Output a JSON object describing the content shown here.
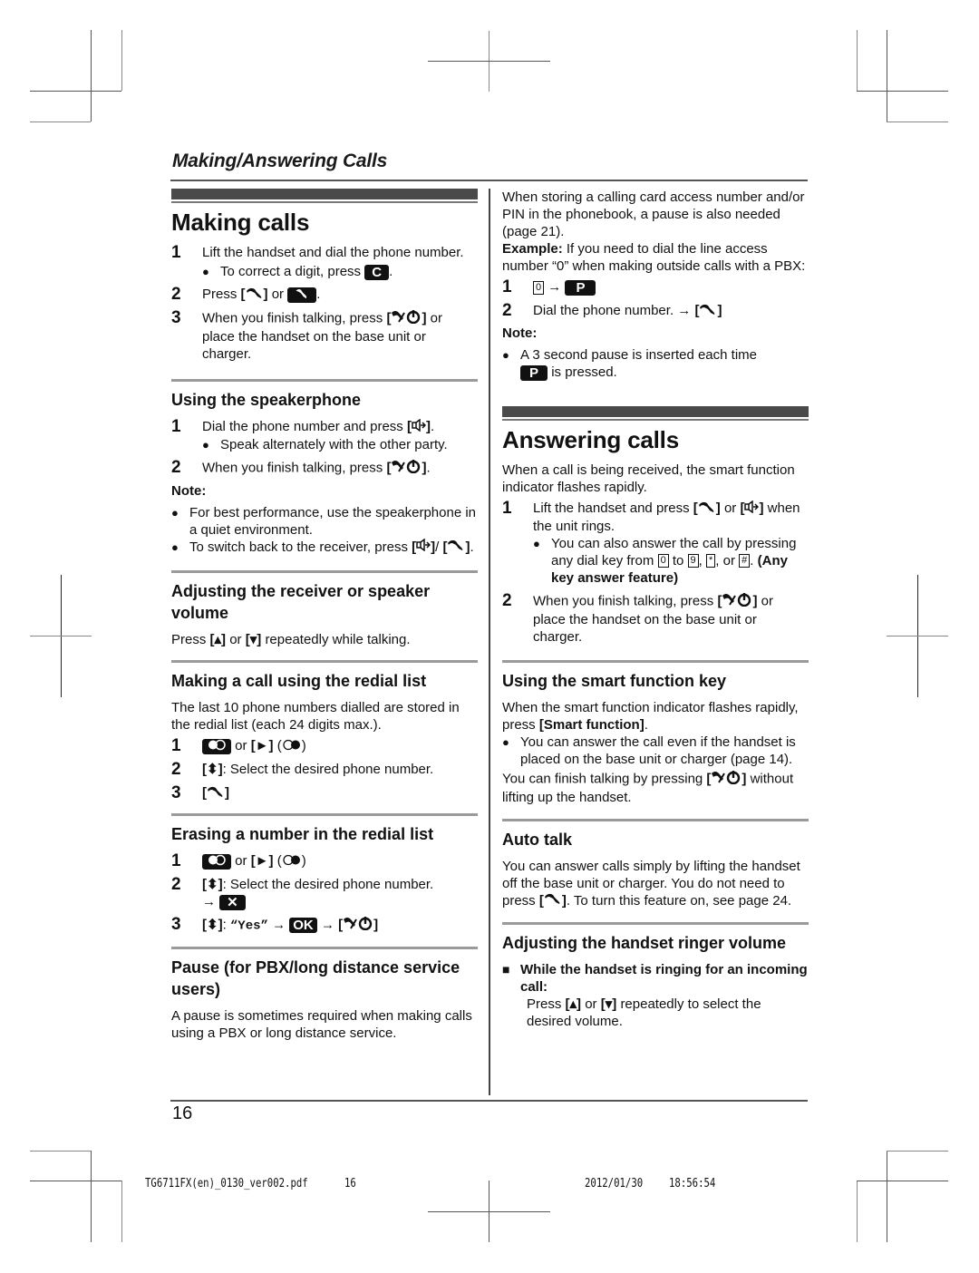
{
  "header": {
    "title": "Making/Answering Calls"
  },
  "left": {
    "making_calls": {
      "title": "Making calls",
      "steps": [
        {
          "num": "1",
          "text": "Lift the handset and dial the phone number.",
          "bullet": "To correct a digit, press",
          "key": "C"
        },
        {
          "num": "2",
          "text_a": "Press",
          "text_b": "or"
        },
        {
          "num": "3",
          "text_a": "When you finish talking, press",
          "text_b": "or place the handset on the base unit or charger."
        }
      ]
    },
    "speakerphone": {
      "title": "Using the speakerphone",
      "steps": [
        {
          "num": "1",
          "text": "Dial the phone number and press",
          "bullet": "Speak alternately with the other party."
        },
        {
          "num": "2",
          "text": "When you finish talking, press"
        }
      ],
      "note_label": "Note:",
      "notes": [
        "For best performance, use the speakerphone in a quiet environment.",
        "To switch back to the receiver, press"
      ]
    },
    "volume": {
      "title": "Adjusting the receiver or speaker volume",
      "text_a": "Press",
      "text_b": "or",
      "text_c": "repeatedly while talking."
    },
    "redial": {
      "title": "Making a call using the redial list",
      "intro": "The last 10 phone numbers dialled are stored in the redial list (each 24 digits max.).",
      "steps": [
        {
          "num": "1",
          "text": "or"
        },
        {
          "num": "2",
          "text": ": Select the desired phone number."
        },
        {
          "num": "3"
        }
      ]
    },
    "erase": {
      "title": "Erasing a number in the redial list",
      "steps": [
        {
          "num": "1",
          "text": "or"
        },
        {
          "num": "2",
          "text": ": Select the desired phone number."
        },
        {
          "num": "3",
          "yes": "“Yes”",
          "ok": "OK"
        }
      ]
    },
    "pause": {
      "title": "Pause (for PBX/long distance service users)",
      "text": "A pause is sometimes required when making calls using a PBX or long distance service."
    }
  },
  "right": {
    "pause_cont": {
      "text": "When storing a calling card access number and/or PIN in the phonebook, a pause is also needed (page 21).",
      "example_label": "Example:",
      "example_text": "If you need to dial the line access number “0” when making outside calls with a PBX:",
      "steps": [
        {
          "num": "1",
          "digit": "0",
          "key": "P"
        },
        {
          "num": "2",
          "text": "Dial the phone number."
        }
      ],
      "note_label": "Note:",
      "note_a": "A 3 second pause is inserted each time",
      "note_key": "P",
      "note_b": "is pressed."
    },
    "answering": {
      "title": "Answering calls",
      "intro": "When a call is being received, the smart function indicator flashes rapidly.",
      "steps": [
        {
          "num": "1",
          "text_a": "Lift the handset and press",
          "text_b": "or",
          "text_c": "when the unit rings.",
          "bullet_a": "You can also answer the call by pressing any dial key from",
          "k0": "0",
          "to": "to",
          "k9": "9",
          "kstar": "*",
          "or": ", or",
          "khash": "#",
          "feature": "(Any key answer feature)"
        },
        {
          "num": "2",
          "text_a": "When you finish talking, press",
          "text_b": "or place the handset on the base unit or charger."
        }
      ]
    },
    "smart": {
      "title": "Using the smart function key",
      "text_a": "When the smart function indicator flashes rapidly, press",
      "key": "Smart function",
      "bullet": "You can answer the call even if the handset is placed on the base unit or charger (page 14).",
      "text_b": "You can finish talking by pressing",
      "text_c": "without lifting up the handset."
    },
    "autotalk": {
      "title": "Auto talk",
      "text_a": "You can answer calls simply by lifting the handset off the base unit or charger. You do not need to press",
      "text_b": ". To turn this feature on, see page 24."
    },
    "ringer": {
      "title": "Adjusting the handset ringer volume",
      "item": "While the handset is ringing for an incoming call:",
      "text_a": "Press",
      "text_b": "or",
      "text_c": "repeatedly to select the desired volume."
    }
  },
  "footer": {
    "page_number": "16",
    "file": "TG6711FX(en)_0130_ver002.pdf",
    "file_page": "16",
    "date": "2012/01/30",
    "time": "18:56:54"
  }
}
